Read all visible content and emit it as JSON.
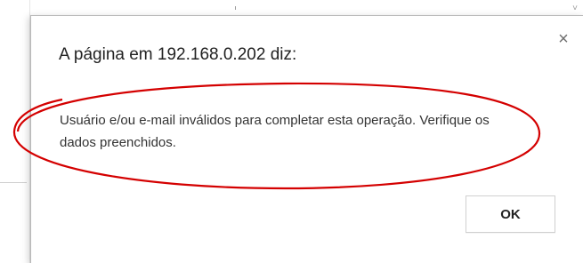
{
  "dialog": {
    "title": "A página em 192.168.0.202 diz:",
    "message": "Usuário e/ou e-mail inválidos para completar esta operação. Verifique os dados preenchidos.",
    "ok_label": "OK",
    "close_glyph": "×",
    "close_icon": "close-icon"
  },
  "annotation": {
    "shape": "ellipse",
    "color": "#d40000"
  }
}
